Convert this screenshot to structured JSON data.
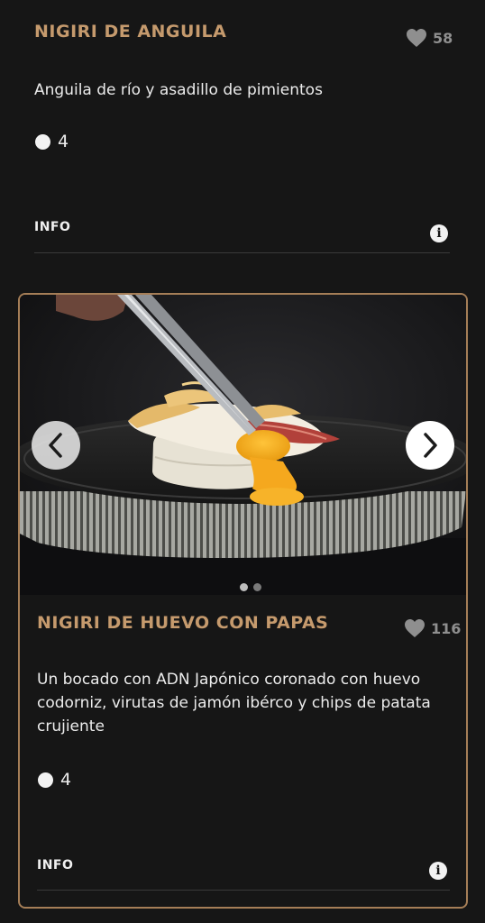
{
  "items": [
    {
      "title": "NIGIRI DE ANGUILA",
      "likes": "58",
      "description": "Anguila de río y asadillo de pimientos",
      "count": "4",
      "info_label": "INFO",
      "info_icon": "info-icon"
    },
    {
      "title": "NIGIRI DE HUEVO CON PAPAS",
      "likes": "116",
      "description": "Un bocado con ADN Japónico coronado con huevo codorniz, virutas de jamón ibérco y chips de patata crujiente",
      "count": "4",
      "info_label": "INFO",
      "info_icon": "info-icon",
      "gallery": {
        "prev_icon": "chevron-left-icon",
        "next_icon": "chevron-right-icon",
        "image": "nigiri-quail-egg-photo",
        "pages": 2,
        "active_page": 1
      }
    }
  ],
  "colors": {
    "background": "#161616",
    "accent": "#c59a6d",
    "card_border": "#a57e57",
    "muted": "#8f8f8f"
  }
}
